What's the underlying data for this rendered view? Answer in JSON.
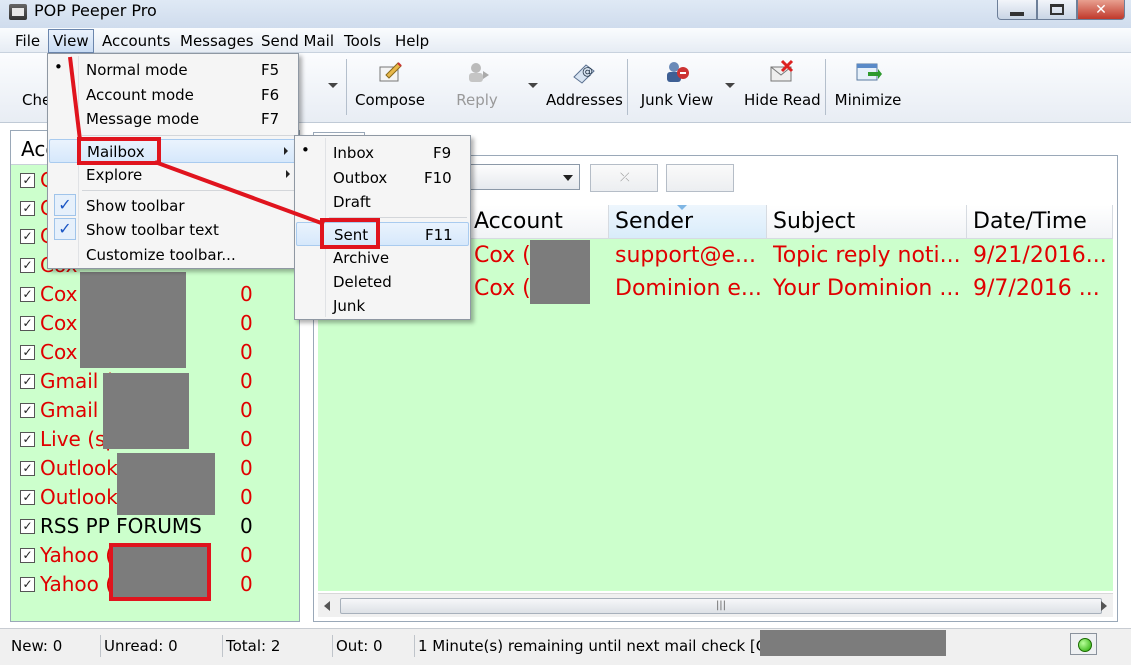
{
  "window": {
    "title": "POP Peeper Pro"
  },
  "menubar": {
    "items": [
      {
        "label": "File"
      },
      {
        "label": "View"
      },
      {
        "label": "Accounts"
      },
      {
        "label": "Messages"
      },
      {
        "label": "Send Mail"
      },
      {
        "label": "Tools"
      },
      {
        "label": "Help"
      }
    ]
  },
  "toolbar": {
    "check_label": "Che",
    "compose_label": "Compose",
    "reply_label": "Reply",
    "addresses_label": "Addresses",
    "junk_view_label": "Junk View",
    "hide_read_label": "Hide Read",
    "minimize_label": "Minimize"
  },
  "view_menu": {
    "items": [
      {
        "label": "Normal mode",
        "shortcut": "F5"
      },
      {
        "label": "Account mode",
        "shortcut": "F6"
      },
      {
        "label": "Message mode",
        "shortcut": "F7"
      },
      {
        "label": "Mailbox"
      },
      {
        "label": "Explore"
      },
      {
        "label": "Show toolbar"
      },
      {
        "label": "Show toolbar text"
      },
      {
        "label": "Customize toolbar..."
      }
    ]
  },
  "mailbox_menu": {
    "items": [
      {
        "label": "Inbox",
        "shortcut": "F9"
      },
      {
        "label": "Outbox",
        "shortcut": "F10"
      },
      {
        "label": "Draft"
      },
      {
        "label": "Sent",
        "shortcut": "F11"
      },
      {
        "label": "Archive"
      },
      {
        "label": "Deleted"
      },
      {
        "label": "Junk"
      }
    ]
  },
  "accounts_panel": {
    "header": "Acc",
    "rows": [
      {
        "name": "C",
        "count": ""
      },
      {
        "name": "C",
        "count": ""
      },
      {
        "name": "C",
        "count": ""
      },
      {
        "name": "Cox",
        "count": ""
      },
      {
        "name": "Cox",
        "count": "0"
      },
      {
        "name": "Cox",
        "count": "0"
      },
      {
        "name": "Cox",
        "count": "0"
      },
      {
        "name": "Gmail (",
        "count": "0"
      },
      {
        "name": "Gmail (",
        "count": "0"
      },
      {
        "name": "Live (sp",
        "count": "0"
      },
      {
        "name": "Outlook",
        "count": "0"
      },
      {
        "name": "Outlook",
        "count": "0"
      },
      {
        "name": "RSS PP FORUMS",
        "count": "0"
      },
      {
        "name": "Yahoo (",
        "count": "0"
      },
      {
        "name": "Yahoo (",
        "count": "0"
      }
    ]
  },
  "message_list": {
    "columns": [
      "Account",
      "Sender",
      "Subject",
      "Date/Time"
    ],
    "rows": [
      {
        "account": "Cox (",
        "sender": "support@e...",
        "subject": "Topic reply noti...",
        "date": "9/21/2016..."
      },
      {
        "account": "Cox (",
        "sender": "Dominion e...",
        "subject": "Your Dominion ...",
        "date": "9/7/2016 ..."
      }
    ]
  },
  "statusbar": {
    "new": "New: 0",
    "unread": "Unread: 0",
    "total": "Total: 2",
    "out": "Out: 0",
    "message": "1 Minute(s) remaining until next mail check [Cox ("
  },
  "colors": {
    "unread_text": "#e00000",
    "list_bg": "#ccffcc",
    "annotation": "#e0141e"
  }
}
